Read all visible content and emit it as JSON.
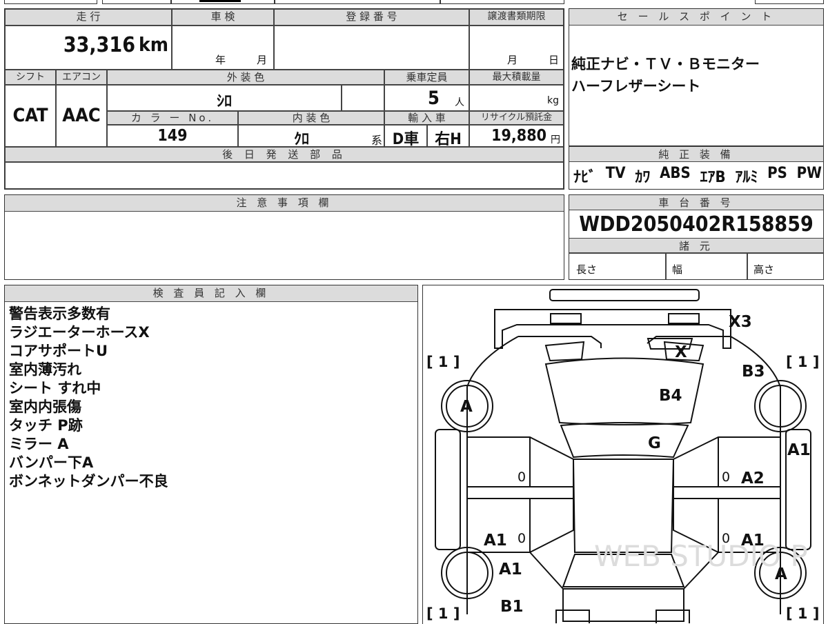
{
  "vehicle": {
    "mileage_label": "走 行",
    "mileage": "33,316",
    "mileage_unit": "km",
    "shaken_label": "車 検",
    "shaken_year": "年",
    "shaken_month": "月",
    "reg_label": "登 録 番 号",
    "transfer_label": "譲渡書類期限",
    "transfer_month": "月",
    "transfer_day": "日",
    "shift_label": "シフト",
    "shift": "CAT",
    "ac_label": "エアコン",
    "ac": "AAC",
    "ext_color_label": "外 装 色",
    "ext_color": "ｼﾛ",
    "capacity_label": "乗車定員",
    "capacity": "5",
    "capacity_unit": "人",
    "max_load_label": "最大積載量",
    "max_load_unit": "kg",
    "color_no_label": "カ ラ ー No.",
    "color_no": "149",
    "int_color_label": "内 装 色",
    "int_color": "ｸﾛ",
    "int_color_suffix": "系",
    "import_label": "輸 入 車",
    "import_dealer": "D車",
    "handle": "右H",
    "recycle_label": "リサイクル預託金",
    "recycle_fee": "19,880",
    "recycle_unit": "円",
    "later_parts_label": "後 日 発 送 部 品"
  },
  "sales_points": {
    "label": "セ ー ル ス ポ イ ン ト",
    "lines": [
      "純正ナビ・ＴＶ・Ｂモニター",
      "ハーフレザーシート"
    ]
  },
  "equipment": {
    "label": "純 正 装 備",
    "items": [
      "ﾅﾋﾞ",
      "TV",
      "ｶﾜ",
      "ABS",
      "ｴｱB",
      "ｱﾙﾐ",
      "PS",
      "PW"
    ]
  },
  "notes": {
    "label": "注 意 事 項 欄"
  },
  "chassis": {
    "label": "車 台 番 号",
    "number": "WDD2050402R158859"
  },
  "specs": {
    "label": "諸 元",
    "length": "長さ",
    "width": "幅",
    "height": "高さ"
  },
  "inspector": {
    "label": "検 査 員 記 入 欄",
    "lines": [
      "警告表示多数有",
      "ラジエーターホースX",
      "コアサポートU",
      "室内薄汚れ",
      "シート すれ中",
      "室内内張傷",
      "タッチ P跡",
      "ミラー A",
      "バンパー下A",
      "ボンネットダンパー不良"
    ]
  },
  "diagram": {
    "marks": {
      "x3": "X3",
      "x": "X",
      "b3": "B3",
      "b4": "B4",
      "g": "G",
      "a_fl": "A",
      "a1_r": "A1",
      "a2": "A2",
      "a1_rl": "A1",
      "a1_rr": "A1",
      "a1_l": "A1",
      "a_rr": "A",
      "b1": "B1",
      "zero1": "0",
      "zero2": "0",
      "zero3": "0",
      "zero4": "0",
      "br_tl": "[ 1 ]",
      "br_tr": "[ 1 ]",
      "br_bl": "[ 1 ]",
      "br_br": "[ 1 ]"
    },
    "watermark": "WEB STUDIO P"
  }
}
